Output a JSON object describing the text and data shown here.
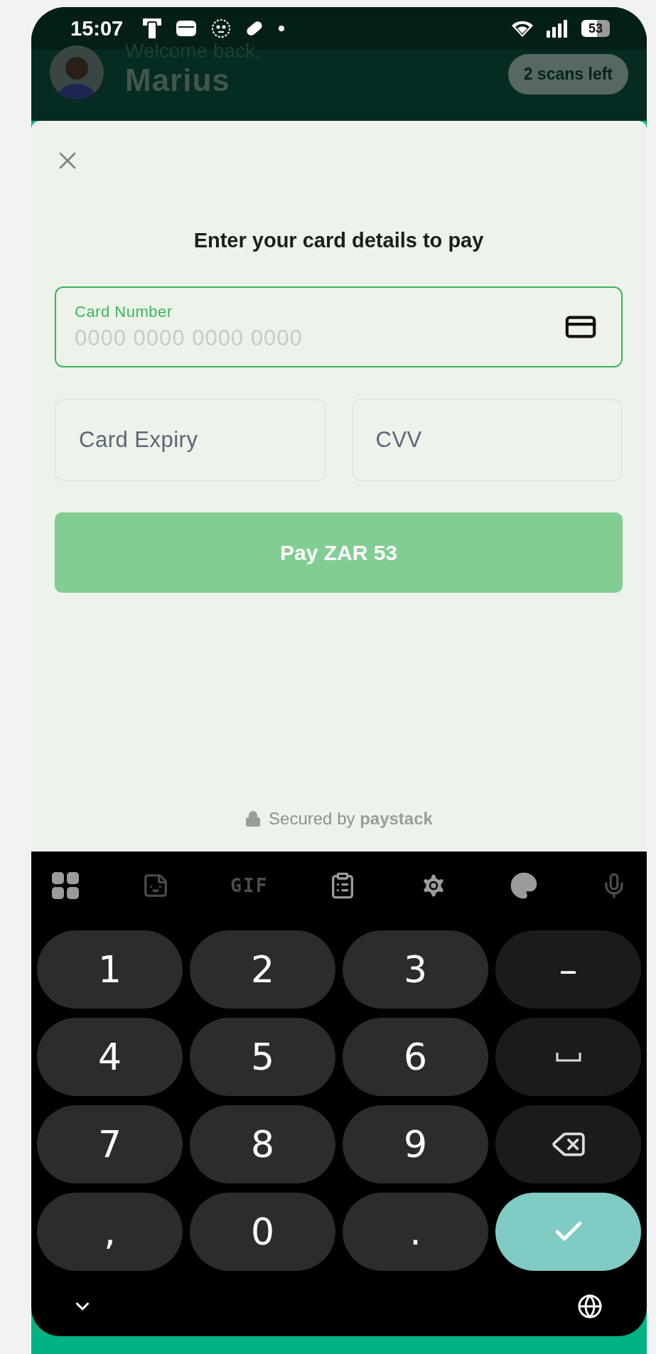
{
  "status_bar": {
    "time": "15:07",
    "battery": "53"
  },
  "header": {
    "greeting": "Welcome back,",
    "name": "Marius",
    "scans_badge": "2 scans left"
  },
  "payment_sheet": {
    "title": "Enter your card details to pay",
    "card_number": {
      "label": "Card Number",
      "placeholder": "0000 0000 0000 0000",
      "focused": true
    },
    "card_expiry": {
      "placeholder": "Card Expiry",
      "focused": false
    },
    "cvv": {
      "placeholder": "CVV",
      "focused": false
    },
    "pay_button": {
      "label": "Pay ZAR 53",
      "disabled": true
    },
    "footer": "Secured by **paystack**"
  },
  "keyboard": {
    "toolbar": [
      {
        "kind": "apps",
        "disabled": false
      },
      {
        "kind": "sticker",
        "disabled": true
      },
      {
        "kind": "gif",
        "label": "GIF",
        "disabled": true
      },
      {
        "kind": "clipboard",
        "disabled": false
      },
      {
        "kind": "settings",
        "disabled": false
      },
      {
        "kind": "palette",
        "disabled": false
      },
      {
        "kind": "mic",
        "disabled": true
      }
    ],
    "keys": [
      {
        "kind": "digit",
        "label": "1"
      },
      {
        "kind": "digit",
        "label": "2"
      },
      {
        "kind": "digit",
        "label": "3"
      },
      {
        "kind": "function",
        "label": "–"
      },
      {
        "kind": "digit",
        "label": "4"
      },
      {
        "kind": "digit",
        "label": "5"
      },
      {
        "kind": "digit",
        "label": "6"
      },
      {
        "kind": "space"
      },
      {
        "kind": "digit",
        "label": "7"
      },
      {
        "kind": "digit",
        "label": "8"
      },
      {
        "kind": "digit",
        "label": "9"
      },
      {
        "kind": "backspace"
      },
      {
        "kind": "digit",
        "label": ","
      },
      {
        "kind": "digit",
        "label": "0"
      },
      {
        "kind": "digit",
        "label": "."
      },
      {
        "kind": "enter"
      }
    ]
  }
}
